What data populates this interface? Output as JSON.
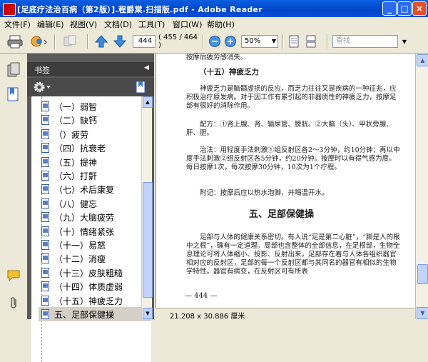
{
  "window": {
    "title": "[足底疗法治百病（第2版）].程爵棠.扫描版.pdf - Adobe Reader"
  },
  "menu": [
    "文件(F)",
    "编辑(E)",
    "视图(V)",
    "文档(D)",
    "工具(T)",
    "窗口(W)",
    "帮助(H)"
  ],
  "toolbar": {
    "page_current": "444",
    "page_total": "( 455 / 464 )",
    "zoom": "50%",
    "search_placeholder": "查找"
  },
  "bookmarks_panel": {
    "title": "书签",
    "items": [
      "（一）弱智",
      "（二）缺钙",
      "（）疲劳",
      "（四）抗衰老",
      "（五）提神",
      "（六）打鼾",
      "（七）术后康复",
      "（八）健忘",
      "（九）大脑疲劳",
      "（十）情绪紧张",
      "（十一）易怒",
      "（十二）消瘦",
      "（十三）皮肤粗糙",
      "（十四）体质虚弱",
      "（十五）神疲乏力",
      "五、足部保健操"
    ],
    "selected_index": 15
  },
  "document": {
    "top_fragment": "按摩后疲劳感消失。",
    "section_heading": "（十五）神疲乏力",
    "para1": "神疲乏力是脑髓虚损的反应，而乏力往往又是疾病的一种征兆，应积极治疗原发病。对于因工作有累引起的非器质性的神疲乏力，按摩足部有很好的消除作用。",
    "para2": "配方：①肾上腺、肾、输尿管、膀胱。②大脑（头）、甲状旁腺、肝、胆。",
    "para3": "治法：用轻度手法刺激①组反射区各2～3分钟，约10分钟；再以中度手法刺激②组反射区各5分钟，约20分钟。按摩时以有得气感为度。每日按摩1次，每次按摩30分钟，10次为1个疗程。",
    "para4": "附记：按摩后应以热水泡脚，并喝温开水。",
    "chapter_heading": "五、足部保健操",
    "para5": "足部与人体的健康关系密切。有人说“足是第二心脏”，“脚是人的根中之根”，确有一定道理。局部也含整体的全部信息，在足根部，生物全息理论可将人体缩小、投影、反射出来，足部存在着与人体各组织器官相对应的反射区，足部的每一个反射区都与其同名的器官有相似的生物学特性。器官有病变，在反射区可有所表",
    "page_number": "— 444 —"
  },
  "status": {
    "page_size": "21.208 x 30.886 厘米"
  }
}
